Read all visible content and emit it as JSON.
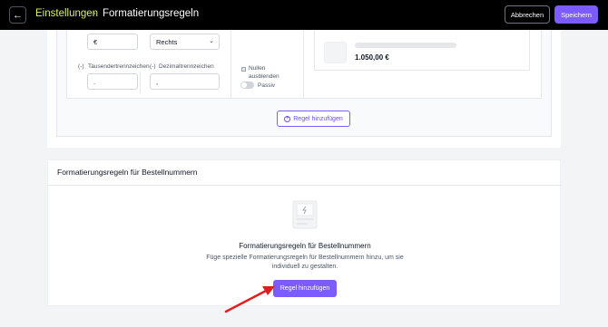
{
  "header": {
    "back_icon": "arrow-left-icon",
    "breadcrumb_root": "Einstellungen",
    "breadcrumb_separator": "›",
    "page_title": "Formatierungsregeln",
    "cancel_label": "Abbrechen",
    "save_label": "Speichern",
    "accent_color": "#7c5cff",
    "breadcrumb_color": "#d9ef6a"
  },
  "rule_form": {
    "currency_symbol_value": "€",
    "position_select_value": "Rechts",
    "thousands_separator_label": "Tausendertrennzeichen",
    "thousands_separator_value": ".",
    "decimal_separator_label": "Dezimaltrennzeichen",
    "decimal_separator_value": ",",
    "hide_zeros_label": "Nullen ausblenden",
    "passive_label": "Passiv",
    "preview_price": "1.050,00 €",
    "add_rule_label": "Regel hinzufügen"
  },
  "order_numbers": {
    "section_title": "Formatierungsregeln für Bestellnummern",
    "empty_title": "Formatierungsregeln für Bestellnummern",
    "empty_description": "Füge spezielle Formatierungsregeln für Bestellnummern hinzu, um sie individuell zu gestalten.",
    "add_rule_label": "Regel hinzufügen"
  }
}
